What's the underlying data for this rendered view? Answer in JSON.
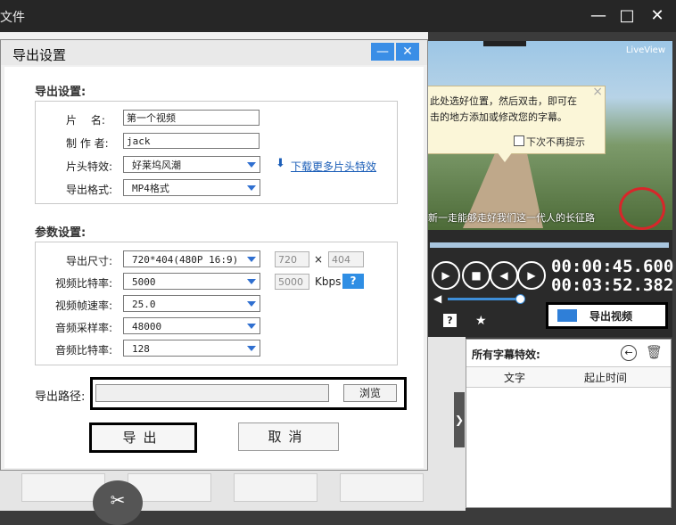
{
  "app": {
    "title": "文件"
  },
  "preview": {
    "badge": "LiveView",
    "tip_line1": "此处选好位置，然后双击，即可在",
    "tip_line2": "击的地方添加或修改您的字幕。",
    "tip_checkbox": "下次不再提示",
    "subtitle": "新一走能够走好我们这一代人的长征路"
  },
  "player": {
    "current_time": "00:00:45.600",
    "total_time": "00:03:52.382",
    "volume_fraction": 0.95,
    "export_video_label": "导出视频"
  },
  "subtitle_panel": {
    "title": "所有字幕特效:",
    "columns": [
      "文字",
      "起止时间"
    ]
  },
  "dialog": {
    "title": "导出设置",
    "export_settings": {
      "section_label": "导出设置:",
      "name_label": "片　 名:",
      "name_value": "第一个视频",
      "author_label": "制 作 者:",
      "author_value": "jack",
      "intro_label": "片头特效:",
      "intro_value": "好莱坞风潮",
      "download_link": "下载更多片头特效",
      "format_label": "导出格式:",
      "format_value": "MP4格式"
    },
    "params": {
      "section_label": "参数设置:",
      "size_label": "导出尺寸:",
      "size_value": "720*404(480P 16:9)",
      "width": "720",
      "times": "×",
      "height": "404",
      "vbitrate_label": "视频比特率:",
      "vbitrate_value": "5000",
      "vbitrate_field": "5000",
      "kbps": "Kbps",
      "help": "?",
      "fps_label": "视频帧速率:",
      "fps_value": "25.0",
      "asample_label": "音频采样率:",
      "asample_value": "48000",
      "abitrate_label": "音频比特率:",
      "abitrate_value": "128"
    },
    "path_label": "导出路径:",
    "path_value": "",
    "browse": "浏览",
    "export": "导出",
    "cancel": "取消"
  }
}
